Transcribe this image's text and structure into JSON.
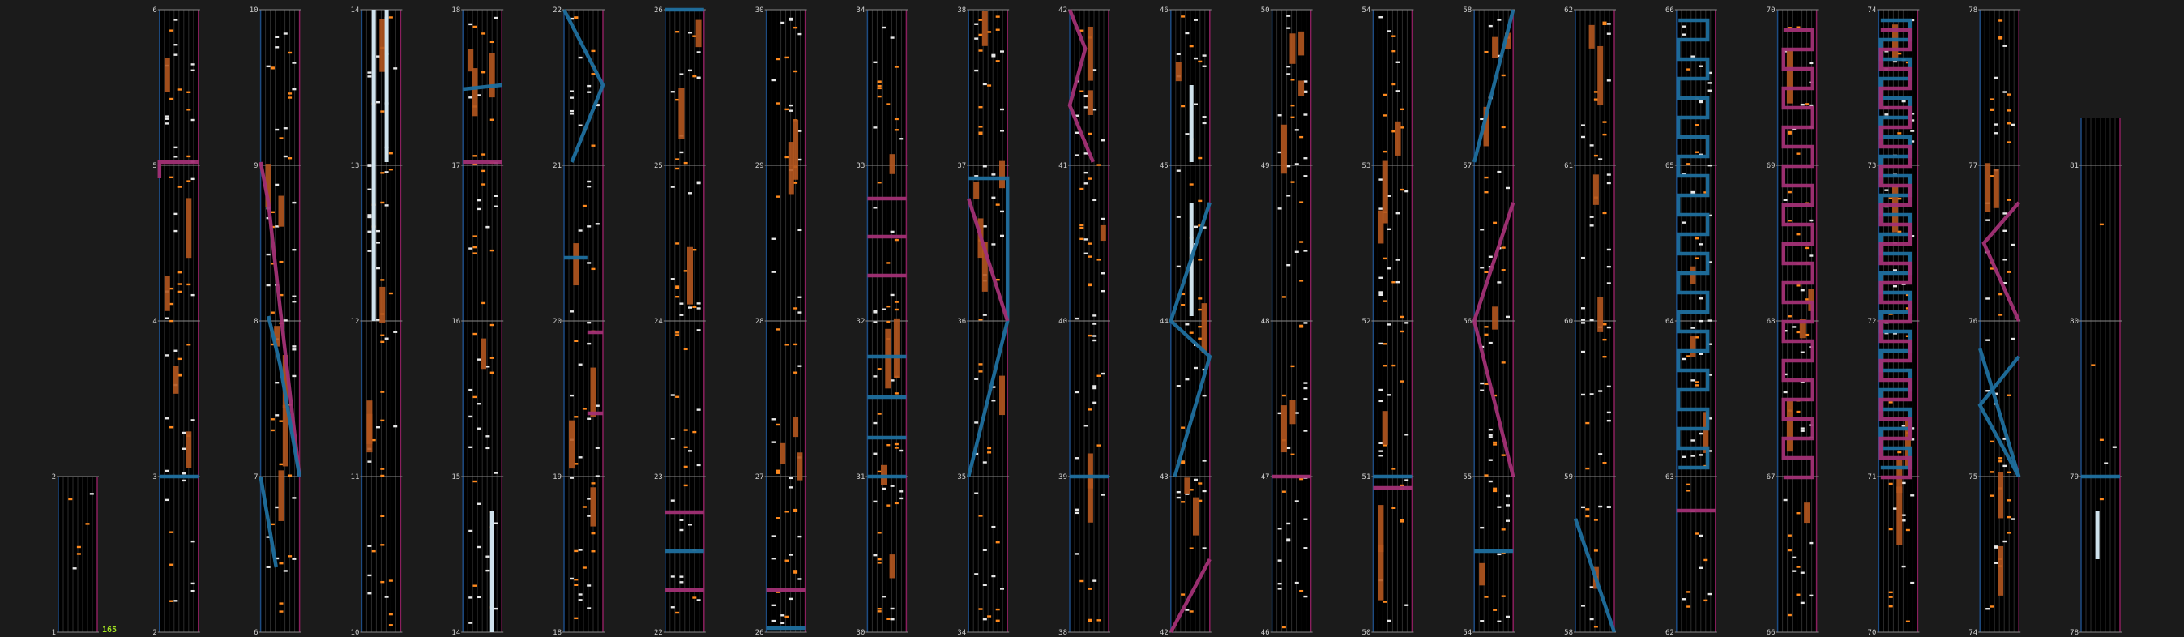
{
  "colors": {
    "background": "#1b1b1b",
    "lane_bg": "#000000",
    "lane_line": "#2c2c2c",
    "border_left": "#1d4b82",
    "border_right": "#8a1f5e",
    "measure_line": "#8a8a8a",
    "note_white": "#e8e8e8",
    "note_orange": "#ff8a1e",
    "long_orange": "#b4571f",
    "long_white": "#cfe2ec",
    "scratch_blue": "#1f6f9e",
    "scratch_pink": "#a23075",
    "label": "#d0d0d0",
    "bpm": "#a0e020"
  },
  "bpm_marker": "165",
  "measures": [
    {
      "num": "1",
      "col": 0,
      "row": 0
    },
    {
      "num": "2",
      "col": 0,
      "row": 1
    },
    {
      "num": "2",
      "col": 1,
      "row": 0
    },
    {
      "num": "3",
      "col": 1,
      "row": 1
    },
    {
      "num": "4",
      "col": 1,
      "row": 2
    },
    {
      "num": "5",
      "col": 1,
      "row": 3
    },
    {
      "num": "6",
      "col": 1,
      "row": 4
    },
    {
      "num": "6",
      "col": 2,
      "row": 0
    },
    {
      "num": "7",
      "col": 2,
      "row": 1
    },
    {
      "num": "8",
      "col": 2,
      "row": 2
    },
    {
      "num": "9",
      "col": 2,
      "row": 3
    },
    {
      "num": "10",
      "col": 2,
      "row": 4
    },
    {
      "num": "10",
      "col": 3,
      "row": 0
    },
    {
      "num": "11",
      "col": 3,
      "row": 1
    },
    {
      "num": "12",
      "col": 3,
      "row": 2
    },
    {
      "num": "13",
      "col": 3,
      "row": 3
    },
    {
      "num": "14",
      "col": 3,
      "row": 4
    },
    {
      "num": "14",
      "col": 4,
      "row": 0
    },
    {
      "num": "15",
      "col": 4,
      "row": 1
    },
    {
      "num": "16",
      "col": 4,
      "row": 2
    },
    {
      "num": "17",
      "col": 4,
      "row": 3
    },
    {
      "num": "18",
      "col": 4,
      "row": 4
    },
    {
      "num": "18",
      "col": 5,
      "row": 0
    },
    {
      "num": "19",
      "col": 5,
      "row": 1
    },
    {
      "num": "20",
      "col": 5,
      "row": 2
    },
    {
      "num": "21",
      "col": 5,
      "row": 3
    },
    {
      "num": "22",
      "col": 5,
      "row": 4
    },
    {
      "num": "22",
      "col": 6,
      "row": 0
    },
    {
      "num": "23",
      "col": 6,
      "row": 1
    },
    {
      "num": "24",
      "col": 6,
      "row": 2
    },
    {
      "num": "25",
      "col": 6,
      "row": 3
    },
    {
      "num": "26",
      "col": 6,
      "row": 4
    },
    {
      "num": "26",
      "col": 7,
      "row": 0
    },
    {
      "num": "27",
      "col": 7,
      "row": 1
    },
    {
      "num": "28",
      "col": 7,
      "row": 2
    },
    {
      "num": "29",
      "col": 7,
      "row": 3
    },
    {
      "num": "30",
      "col": 7,
      "row": 4
    },
    {
      "num": "30",
      "col": 8,
      "row": 0
    },
    {
      "num": "31",
      "col": 8,
      "row": 1
    },
    {
      "num": "32",
      "col": 8,
      "row": 2
    },
    {
      "num": "33",
      "col": 8,
      "row": 3
    },
    {
      "num": "34",
      "col": 8,
      "row": 4
    },
    {
      "num": "34",
      "col": 9,
      "row": 0
    },
    {
      "num": "35",
      "col": 9,
      "row": 1
    },
    {
      "num": "36",
      "col": 9,
      "row": 2
    },
    {
      "num": "37",
      "col": 9,
      "row": 3
    },
    {
      "num": "38",
      "col": 9,
      "row": 4
    },
    {
      "num": "38",
      "col": 10,
      "row": 0
    },
    {
      "num": "39",
      "col": 10,
      "row": 1
    },
    {
      "num": "40",
      "col": 10,
      "row": 2
    },
    {
      "num": "41",
      "col": 10,
      "row": 3
    },
    {
      "num": "42",
      "col": 10,
      "row": 4
    },
    {
      "num": "42",
      "col": 11,
      "row": 0
    },
    {
      "num": "43",
      "col": 11,
      "row": 1
    },
    {
      "num": "44",
      "col": 11,
      "row": 2
    },
    {
      "num": "45",
      "col": 11,
      "row": 3
    },
    {
      "num": "46",
      "col": 11,
      "row": 4
    },
    {
      "num": "46",
      "col": 12,
      "row": 0
    },
    {
      "num": "47",
      "col": 12,
      "row": 1
    },
    {
      "num": "48",
      "col": 12,
      "row": 2
    },
    {
      "num": "49",
      "col": 12,
      "row": 3
    },
    {
      "num": "50",
      "col": 12,
      "row": 4
    },
    {
      "num": "50",
      "col": 13,
      "row": 0
    },
    {
      "num": "51",
      "col": 13,
      "row": 1
    },
    {
      "num": "52",
      "col": 13,
      "row": 2
    },
    {
      "num": "53",
      "col": 13,
      "row": 3
    },
    {
      "num": "54",
      "col": 13,
      "row": 4
    },
    {
      "num": "54",
      "col": 14,
      "row": 0
    },
    {
      "num": "55",
      "col": 14,
      "row": 1
    },
    {
      "num": "56",
      "col": 14,
      "row": 2
    },
    {
      "num": "57",
      "col": 14,
      "row": 3
    },
    {
      "num": "58",
      "col": 14,
      "row": 4
    },
    {
      "num": "58",
      "col": 15,
      "row": 0
    },
    {
      "num": "59",
      "col": 15,
      "row": 1
    },
    {
      "num": "60",
      "col": 15,
      "row": 2
    },
    {
      "num": "61",
      "col": 15,
      "row": 3
    },
    {
      "num": "62",
      "col": 15,
      "row": 4
    },
    {
      "num": "62",
      "col": 16,
      "row": 0
    },
    {
      "num": "63",
      "col": 16,
      "row": 1
    },
    {
      "num": "64",
      "col": 16,
      "row": 2
    },
    {
      "num": "65",
      "col": 16,
      "row": 3
    },
    {
      "num": "66",
      "col": 16,
      "row": 4
    },
    {
      "num": "66",
      "col": 17,
      "row": 0
    },
    {
      "num": "67",
      "col": 17,
      "row": 1
    },
    {
      "num": "68",
      "col": 17,
      "row": 2
    },
    {
      "num": "69",
      "col": 17,
      "row": 3
    },
    {
      "num": "70",
      "col": 17,
      "row": 4
    },
    {
      "num": "70",
      "col": 18,
      "row": 0
    },
    {
      "num": "71",
      "col": 18,
      "row": 1
    },
    {
      "num": "72",
      "col": 18,
      "row": 2
    },
    {
      "num": "73",
      "col": 18,
      "row": 3
    },
    {
      "num": "74",
      "col": 18,
      "row": 4
    },
    {
      "num": "74",
      "col": 19,
      "row": 0
    },
    {
      "num": "75",
      "col": 19,
      "row": 1
    },
    {
      "num": "76",
      "col": 19,
      "row": 2
    },
    {
      "num": "77",
      "col": 19,
      "row": 3
    },
    {
      "num": "78",
      "col": 19,
      "row": 4
    },
    {
      "num": "78",
      "col": 20,
      "row": 0
    },
    {
      "num": "79",
      "col": 20,
      "row": 1
    },
    {
      "num": "80",
      "col": 20,
      "row": 2
    },
    {
      "num": "81",
      "col": 20,
      "row": 3
    }
  ]
}
